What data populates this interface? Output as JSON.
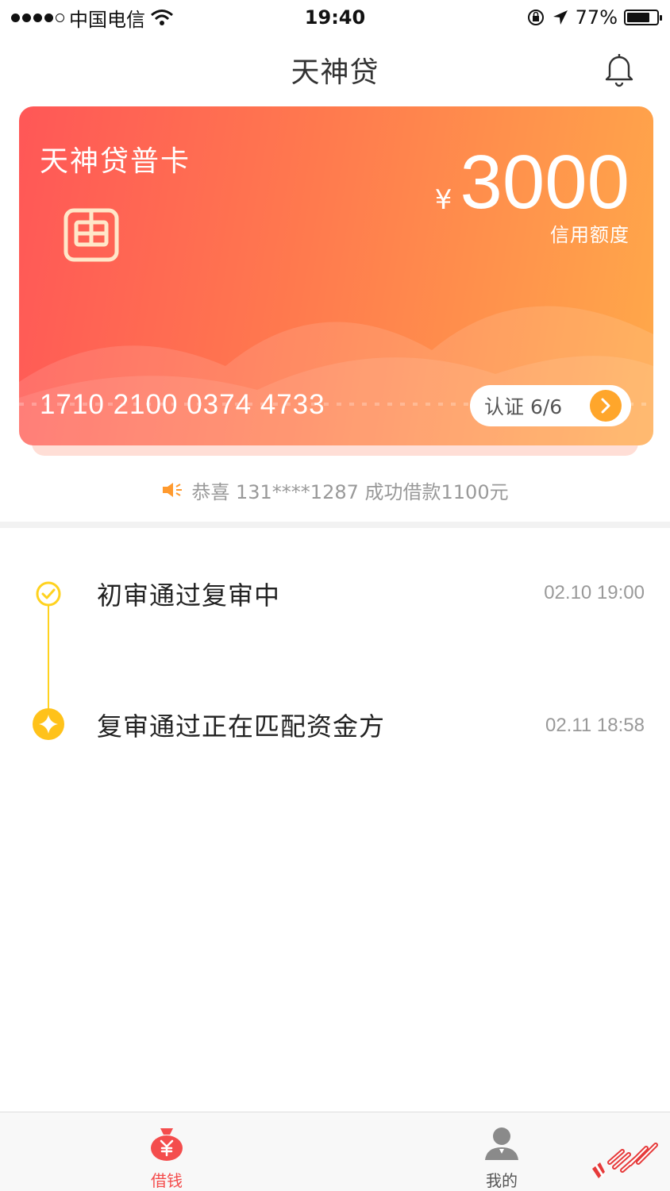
{
  "status_bar": {
    "carrier": "中国电信",
    "time": "19:40",
    "battery": "77%",
    "battery_level": 0.77
  },
  "nav": {
    "title": "天神贷"
  },
  "card": {
    "name": "天神贷普卡",
    "currency": "¥",
    "amount": "3000",
    "credit_label": "信用额度",
    "number": "1710 2100 0374 4733",
    "verify_label": "认证 6/6"
  },
  "notice": {
    "text": "恭喜 131****1287 成功借款1100元"
  },
  "timeline": [
    {
      "title": "初审通过复审中",
      "time": "02.10 19:00",
      "state": "done"
    },
    {
      "title": "复审通过正在匹配资金方",
      "time": "02.11 18:58",
      "state": "current"
    }
  ],
  "tabs": [
    {
      "label": "借钱",
      "active": true
    },
    {
      "label": "我的",
      "active": false
    }
  ],
  "colors": {
    "accent_red": "#f44d4d",
    "timeline_yellow": "#ffd21f",
    "arrow_orange": "#ffa62b"
  }
}
